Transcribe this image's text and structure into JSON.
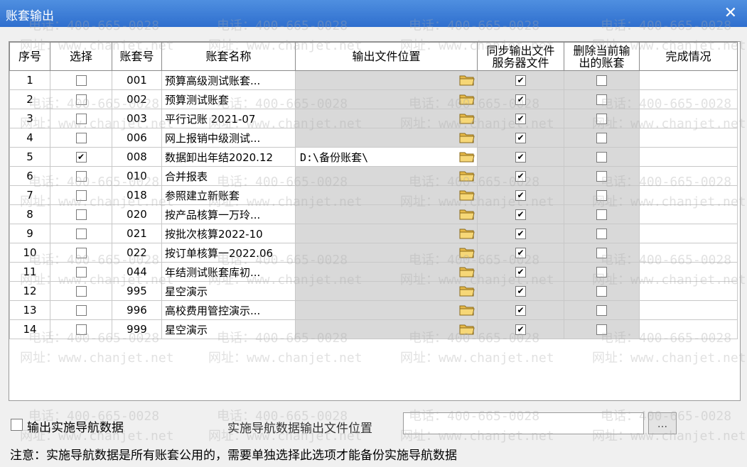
{
  "window": {
    "title": "账套输出",
    "close_glyph": "✕"
  },
  "table": {
    "headers": {
      "seq": "序号",
      "select": "选择",
      "code": "账套号",
      "name": "账套名称",
      "path": "输出文件位置",
      "sync_line1": "同步输出文件",
      "sync_line2": "服务器文件",
      "delete_line1": "删除当前输",
      "delete_line2": "出的账套",
      "status": "完成情况"
    },
    "rows": [
      {
        "seq": "1",
        "selected": false,
        "code": "001",
        "name": "预算高级测试账套...",
        "path": "",
        "sync": true,
        "delete": false
      },
      {
        "seq": "2",
        "selected": false,
        "code": "002",
        "name": "预算测试账套",
        "path": "",
        "sync": true,
        "delete": false
      },
      {
        "seq": "3",
        "selected": false,
        "code": "003",
        "name": "平行记账 2021-07",
        "path": "",
        "sync": true,
        "delete": false
      },
      {
        "seq": "4",
        "selected": false,
        "code": "006",
        "name": "网上报销中级测试...",
        "path": "",
        "sync": true,
        "delete": false
      },
      {
        "seq": "5",
        "selected": true,
        "code": "008",
        "name": "数据卸出年结2020.12",
        "path": "D:\\备份账套\\",
        "sync": true,
        "delete": false
      },
      {
        "seq": "6",
        "selected": false,
        "code": "010",
        "name": "合并报表",
        "path": "",
        "sync": true,
        "delete": false
      },
      {
        "seq": "7",
        "selected": false,
        "code": "018",
        "name": "参照建立新账套",
        "path": "",
        "sync": true,
        "delete": false
      },
      {
        "seq": "8",
        "selected": false,
        "code": "020",
        "name": "按产品核算一万玲...",
        "path": "",
        "sync": true,
        "delete": false
      },
      {
        "seq": "9",
        "selected": false,
        "code": "021",
        "name": "按批次核算2022-10",
        "path": "",
        "sync": true,
        "delete": false
      },
      {
        "seq": "10",
        "selected": false,
        "code": "022",
        "name": "按订单核算一2022.06",
        "path": "",
        "sync": true,
        "delete": false
      },
      {
        "seq": "11",
        "selected": false,
        "code": "044",
        "name": "年结测试账套库初...",
        "path": "",
        "sync": true,
        "delete": false
      },
      {
        "seq": "12",
        "selected": false,
        "code": "995",
        "name": "星空演示",
        "path": "",
        "sync": true,
        "delete": false
      },
      {
        "seq": "13",
        "selected": false,
        "code": "996",
        "name": "高校费用管控演示...",
        "path": "",
        "sync": true,
        "delete": false
      },
      {
        "seq": "14",
        "selected": false,
        "code": "999",
        "name": "星空演示",
        "path": "",
        "sync": true,
        "delete": false
      }
    ]
  },
  "footer": {
    "nav_checkbox_label": "输出实施导航数据",
    "nav_checkbox_checked": false,
    "nav_path_label": "实施导航数据输出文件位置",
    "nav_path_value": "",
    "browse_label": "...",
    "note": "注意：实施导航数据是所有账套公用的，需要单独选择此选项才能备份实施导航数据"
  },
  "watermark": {
    "phone": "电话：400-665-0028",
    "site": "网址：www.chanjet.net"
  },
  "colors": {
    "titlebar": "#3a7bd5",
    "disabled_cell": "#d9d9d9"
  }
}
